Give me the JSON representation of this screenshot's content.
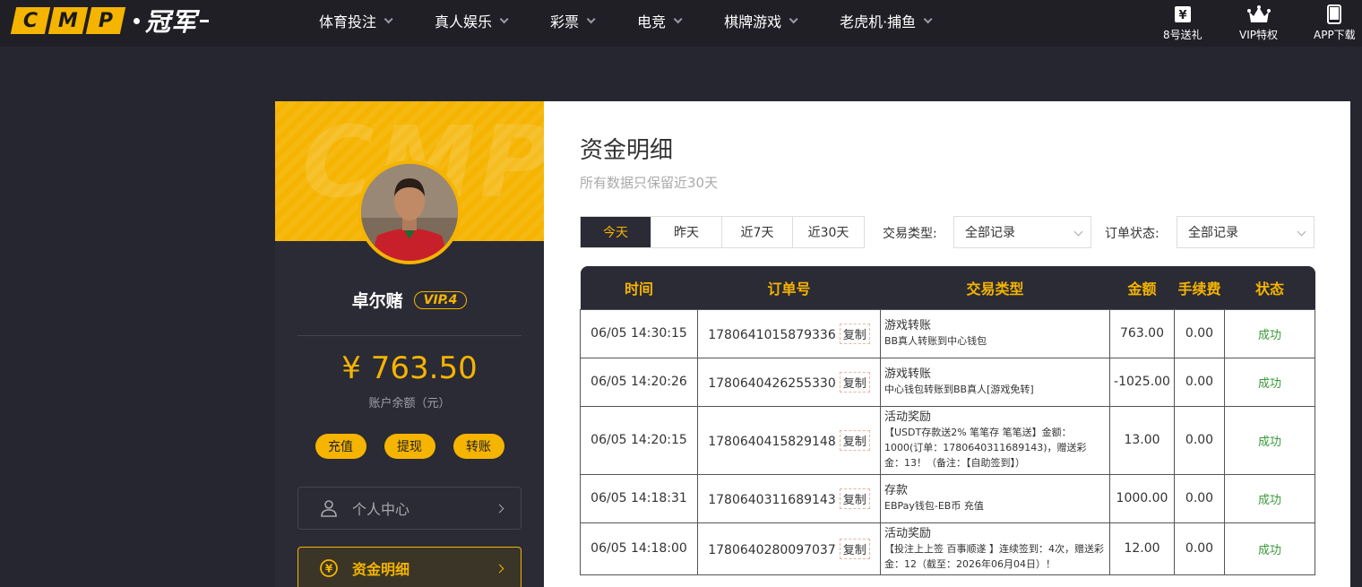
{
  "brand": {
    "logo_letters": [
      "C",
      "M",
      "P"
    ],
    "logo_cn": "冠军"
  },
  "nav": [
    {
      "label": "体育投注"
    },
    {
      "label": "真人娱乐"
    },
    {
      "label": "彩票"
    },
    {
      "label": "电竞"
    },
    {
      "label": "棋牌游戏"
    },
    {
      "label": "老虎机·捕鱼"
    }
  ],
  "quick_links": [
    {
      "label": "8号送礼",
      "icon": "yen-gift-icon"
    },
    {
      "label": "VIP特权",
      "icon": "crown-icon"
    },
    {
      "label": "APP下载",
      "icon": "phone-icon"
    }
  ],
  "sidebar": {
    "banner_watermark": "CMP",
    "username": "卓尔赌",
    "vip": "VIP.4",
    "balance": "¥ 763.50",
    "balance_label": "账户余额（元）",
    "actions": [
      "充值",
      "提现",
      "转账"
    ],
    "menu": [
      {
        "label": "个人中心",
        "icon": "user-icon"
      },
      {
        "label": "资金明细",
        "icon": "yen-circle-icon"
      }
    ]
  },
  "main": {
    "title": "资金明细",
    "subtitle": "所有数据只保留近30天",
    "tabs": [
      "今天",
      "昨天",
      "近7天",
      "近30天"
    ],
    "filters": {
      "type_label": "交易类型:",
      "type_value": "全部记录",
      "status_label": "订单状态:",
      "status_value": "全部记录"
    },
    "table": {
      "headers": [
        "时间",
        "订单号",
        "交易类型",
        "金额",
        "手续费",
        "状态"
      ],
      "copy_label": "复制",
      "rows": [
        {
          "time": "06/05 14:30:15",
          "order": "1780641015879336",
          "type": "游戏转账",
          "desc": "BB真人转账到中心钱包",
          "amount": "763.00",
          "fee": "0.00",
          "status": "成功"
        },
        {
          "time": "06/05 14:20:26",
          "order": "1780640426255330",
          "type": "游戏转账",
          "desc": "中心钱包转账到BB真人[游戏免转]",
          "amount": "-1025.00",
          "fee": "0.00",
          "status": "成功"
        },
        {
          "time": "06/05 14:20:15",
          "order": "1780640415829148",
          "type": "活动奖励",
          "desc": "【USDT存款送2% 笔笔存 笔笔送】金额：1000(订单：1780640311689143)，赠送彩金：13！（备注：【自助签到】）",
          "amount": "13.00",
          "fee": "0.00",
          "status": "成功"
        },
        {
          "time": "06/05 14:18:31",
          "order": "1780640311689143",
          "type": "存款",
          "desc": "EBPay钱包-EB币 充值",
          "amount": "1000.00",
          "fee": "0.00",
          "status": "成功"
        },
        {
          "time": "06/05 14:18:00",
          "order": "1780640280097037",
          "type": "活动奖励",
          "desc": "【投注上上签 百事顺遂 】连续签到：4次，赠送彩金：12（截至：2026年06月04日）！",
          "amount": "12.00",
          "fee": "0.00",
          "status": "成功"
        }
      ]
    }
  },
  "colors": {
    "accent": "#f5b400",
    "dark": "#2b2b35",
    "background": "#262630",
    "success": "#3a9a3a"
  }
}
